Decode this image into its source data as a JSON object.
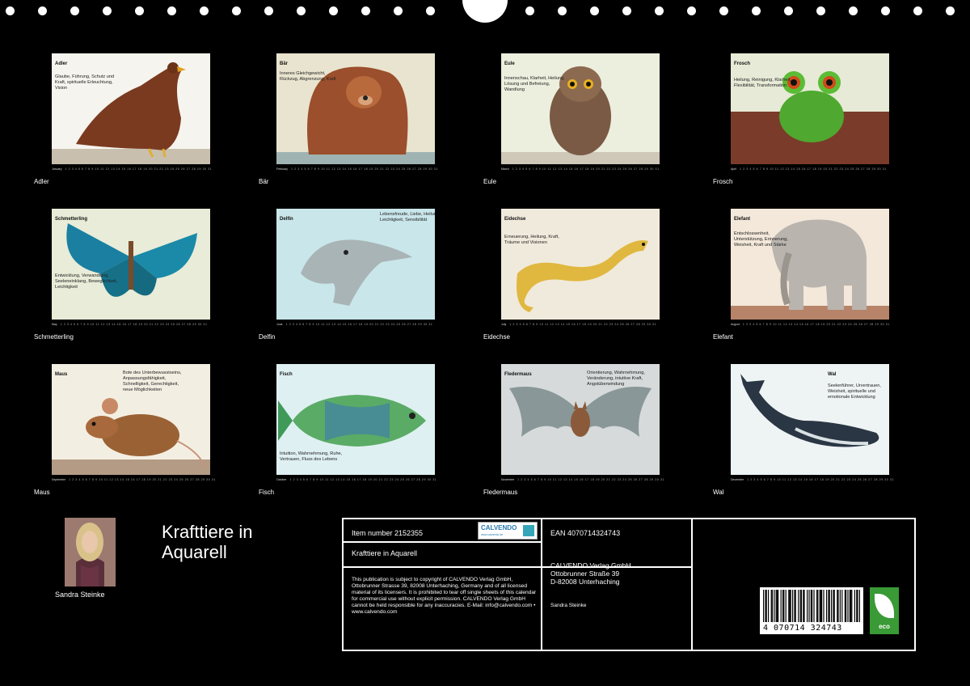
{
  "calendar": {
    "title": "Krafttiere in Aquarell",
    "author": "Sandra Steinke"
  },
  "months": [
    {
      "name": "Adler",
      "caption": "Adler",
      "month_label": "January",
      "desc": "Glaube, Führung, Schutz und Kraft, spirituelle Erleuchtung, Vision"
    },
    {
      "name": "Bär",
      "caption": "Bär",
      "month_label": "February",
      "desc": "Inneres Gleichgewicht, Rückzug, Abgrenzung, Kraft"
    },
    {
      "name": "Eule",
      "caption": "Eule",
      "month_label": "March",
      "desc": "Innenschau, Klarheit, Heilung, Lösung und Befreiung, Wandlung"
    },
    {
      "name": "Frosch",
      "caption": "Frosch",
      "month_label": "April",
      "desc": "Heilung, Reinigung, Klarheit, Flexibilität, Transformation"
    },
    {
      "name": "Schmetterling",
      "caption": "Schmetterling",
      "month_label": "May",
      "desc": "Entwicklung, Verwandlung, Seeleneinklang, Beweglichkeit, Leichtigkeit"
    },
    {
      "name": "Delfin",
      "caption": "Delfin",
      "month_label": "June",
      "desc": "Lebensfreude, Liebe, Heilung, Leichtigkeit, Sensibilität"
    },
    {
      "name": "Eidechse",
      "caption": "Eidechse",
      "month_label": "July",
      "desc": "Erneuerung, Heilung, Kraft, Träume und Visionen"
    },
    {
      "name": "Elefant",
      "caption": "Elefant",
      "month_label": "August",
      "desc": "Entschlossenheit, Unterstützung, Erinnerung, Weisheit, Kraft und Stärke"
    },
    {
      "name": "Maus",
      "caption": "Maus",
      "month_label": "September",
      "desc": "Bote des Unterbewusstseins, Anpassungsfähigkeit, Schnelligkeit, Gerechtigkeit, neue Möglichkeiten"
    },
    {
      "name": "Fisch",
      "caption": "Fisch",
      "month_label": "October",
      "desc": "Intuition, Wahrnehmung, Ruhe, Vertrauen, Fluss des Lebens"
    },
    {
      "name": "Fledermaus",
      "caption": "Fledermaus",
      "month_label": "November",
      "desc": "Orientierung, Wahrnehmung, Veränderung, intuitive Kraft, Angstüberwindung"
    },
    {
      "name": "Wal",
      "caption": "Wal",
      "month_label": "December",
      "desc": "Seelenführer, Urvertrauen, Weisheit, spirituelle und emotionale Entwicklung"
    }
  ],
  "info": {
    "item_number": "Item number 2152355",
    "box_title": "Krafttiere in Aquarell",
    "logo_text": "CALVENDO",
    "logo_sub": "www.calvendo.de",
    "legal": "This publication is subject to copyright of CALVENDO Verlag GmbH, Ottobrunner Strasse 39, 82008 Unterhaching, Germany and of all licensed material of its licensers. It is prohibited to tear off single sheets of this calendar for commercial use without explicit permission. CALVENDO Verlag GmbH cannot be held responsible for any inaccuracies. E-Mail: info@calvendo.com • www.calvendo.com",
    "ean": "EAN 4070714324743",
    "publisher_line1": "CALVENDO Verlag GmbH",
    "publisher_line2": "Ottobrunner Straße 39",
    "publisher_line3": "D-82008 Unterhaching",
    "author": "Sandra Steinke",
    "barcode_number": "4 070714 324743",
    "eco_label": "eco"
  },
  "colors": {
    "background": "#000000",
    "foreground": "#ffffff",
    "eco_green": "#3a9a36",
    "calvendo_blue": "#2a7ab0"
  }
}
